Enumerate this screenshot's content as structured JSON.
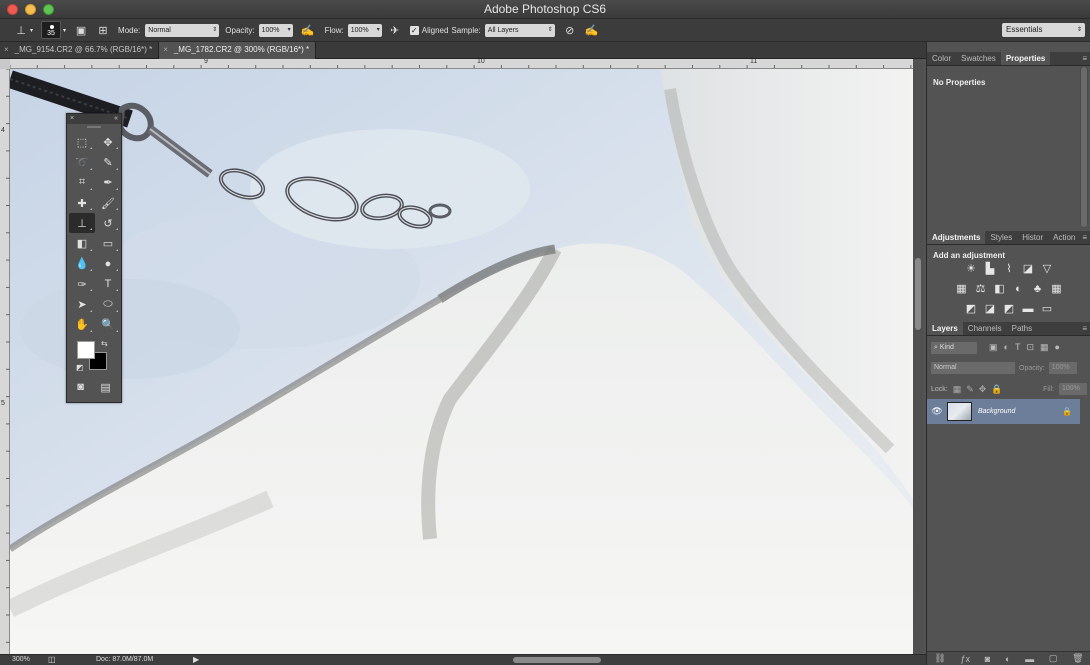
{
  "app_title": "Adobe Photoshop CS6",
  "options_bar": {
    "brush_size": "35",
    "mode_label": "Mode:",
    "mode_value": "Normal",
    "opacity_label": "Opacity:",
    "opacity_value": "100%",
    "flow_label": "Flow:",
    "flow_value": "100%",
    "aligned_label": "Aligned",
    "sample_label": "Sample:",
    "sample_value": "All Layers",
    "workspace": "Essentials"
  },
  "document_tabs": [
    {
      "label": "_MG_9154.CR2 @ 66.7% (RGB/16*) *",
      "active": false
    },
    {
      "label": "_MG_1782.CR2 @ 300% (RGB/16*) *",
      "active": true
    }
  ],
  "rulers": {
    "top": [
      "9",
      "10",
      "11"
    ],
    "left": [
      "4",
      "5"
    ]
  },
  "status_bar": {
    "zoom": "300%",
    "doc_info": "Doc: 87.0M/87.0M"
  },
  "colors": {
    "foreground": "#ffffff",
    "background": "#000000",
    "layer_selected": "#6d7e9a"
  },
  "toolbox": {
    "tools": [
      {
        "name": "rectangular-marquee-icon",
        "glyph": "⬚",
        "active": false
      },
      {
        "name": "move-icon",
        "glyph": "✥",
        "active": false
      },
      {
        "name": "lasso-icon",
        "glyph": "➰",
        "active": false
      },
      {
        "name": "quick-selection-icon",
        "glyph": "✎",
        "active": false
      },
      {
        "name": "crop-icon",
        "glyph": "⌗",
        "active": false
      },
      {
        "name": "eyedropper-icon",
        "glyph": "✒",
        "active": false
      },
      {
        "name": "spot-healing-icon",
        "glyph": "✚",
        "active": false
      },
      {
        "name": "brush-icon",
        "glyph": "🖌",
        "active": false
      },
      {
        "name": "clone-stamp-icon",
        "glyph": "⊥",
        "active": true
      },
      {
        "name": "history-brush-icon",
        "glyph": "↺",
        "active": false
      },
      {
        "name": "eraser-icon",
        "glyph": "◧",
        "active": false
      },
      {
        "name": "gradient-icon",
        "glyph": "▭",
        "active": false
      },
      {
        "name": "blur-icon",
        "glyph": "💧",
        "active": false
      },
      {
        "name": "dodge-icon",
        "glyph": "●",
        "active": false
      },
      {
        "name": "pen-icon",
        "glyph": "✑",
        "active": false
      },
      {
        "name": "type-icon",
        "glyph": "T",
        "active": false
      },
      {
        "name": "path-selection-icon",
        "glyph": "➤",
        "active": false
      },
      {
        "name": "ellipse-icon",
        "glyph": "⬭",
        "active": false
      },
      {
        "name": "hand-icon",
        "glyph": "✋",
        "active": false
      },
      {
        "name": "zoom-icon",
        "glyph": "🔍",
        "active": false
      }
    ]
  },
  "panels": {
    "top_tabs": [
      "Color",
      "Swatches",
      "Properties"
    ],
    "top_active": "Properties",
    "properties_text": "No Properties",
    "adj_tabs": [
      "Adjustments",
      "Styles",
      "Histor",
      "Action"
    ],
    "adj_active": "Adjustments",
    "adj_title": "Add an adjustment",
    "layer_tabs": [
      "Layers",
      "Channels",
      "Paths"
    ],
    "layer_active": "Layers",
    "kind_label": "Kind",
    "blend_mode": "Normal",
    "opacity_label": "Opacity:",
    "opacity_value": "100%",
    "lock_label": "Lock:",
    "fill_label": "Fill:",
    "fill_value": "100%",
    "layer_name": "Background"
  }
}
